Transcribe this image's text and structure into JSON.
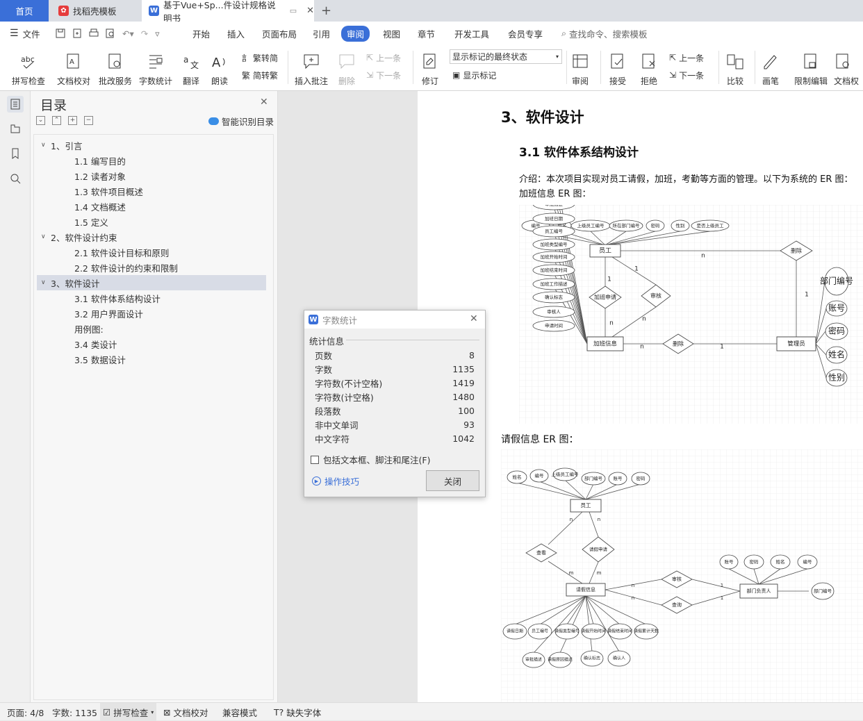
{
  "tabs": {
    "home": "首页",
    "template": "找稻壳模板",
    "doc": "基于Vue+Sp...件设计规格说明书"
  },
  "menu": {
    "file": "文件",
    "items": [
      "开始",
      "插入",
      "页面布局",
      "引用",
      "审阅",
      "视图",
      "章节",
      "开发工具",
      "会员专享"
    ],
    "active": "审阅",
    "search": "查找命令、搜索模板"
  },
  "ribbon": {
    "spell": "拼写检查",
    "doc_check": "文档校对",
    "annot_service": "批改服务",
    "word_count": "字数统计",
    "translate": "翻译",
    "read_aloud": "朗读",
    "t2s": "繁转简",
    "s2t": "简转繁",
    "insert_comment": "插入批注",
    "delete": "删除",
    "prev": "上一条",
    "next": "下一条",
    "revise": "修订",
    "track_state": "显示标记的最终状态",
    "show_markup": "显示标记",
    "review": "审阅",
    "accept": "接受",
    "reject": "拒绝",
    "prev2": "上一条",
    "next2": "下一条",
    "compare": "比较",
    "pen": "画笔",
    "restrict": "限制编辑",
    "doc_perm": "文档权"
  },
  "toc": {
    "title": "目录",
    "smart": "智能识别目录",
    "items": [
      {
        "label": "1、引言",
        "level": 1
      },
      {
        "label": "1.1  编写目的",
        "level": 2
      },
      {
        "label": "1.2  读者对象",
        "level": 2
      },
      {
        "label": "1.3  软件项目概述",
        "level": 2
      },
      {
        "label": "1.4  文档概述",
        "level": 2
      },
      {
        "label": "1.5  定义",
        "level": 2
      },
      {
        "label": "2、软件设计约束",
        "level": 1
      },
      {
        "label": "2.1  软件设计目标和原则",
        "level": 2
      },
      {
        "label": "2.2  软件设计的约束和限制",
        "level": 2
      },
      {
        "label": "3、软件设计",
        "level": 1
      },
      {
        "label": "3.1  软件体系结构设计",
        "level": 2
      },
      {
        "label": "3.2  用户界面设计",
        "level": 2
      },
      {
        "label": "用例图:",
        "level": 2
      },
      {
        "label": "3.4  类设计",
        "level": 2
      },
      {
        "label": "3.5  数据设计",
        "level": 2
      }
    ]
  },
  "document": {
    "h1": "3、软件设计",
    "h2": "3.1  软件体系结构设计",
    "intro1": "介绍：本次项目实现对员工请假，加班，考勤等方面的管理。以下为系统的 ER 图：",
    "intro2": "加班信息 ER 图：",
    "leave_caption": "请假信息 ER 图："
  },
  "er1": {
    "top_attrs": [
      "编号",
      "姓名",
      "上级员工编号",
      "所在部门编号",
      "密码",
      "性别",
      "是否上级员工"
    ],
    "employee": "员工",
    "delete1": "删除",
    "overtime_apply": "加班申请",
    "audit": "审核",
    "overtime_info": "加班信息",
    "delete2": "删除",
    "manager": "管理员",
    "left_attrs": [
      "审批描述",
      "加班日期",
      "员工编号",
      "加班类型编号",
      "加班开始时间",
      "加班结束时间",
      "加班工作描述",
      "确认标志",
      "审核人",
      "申请时间"
    ],
    "right_attrs": [
      "部门编号",
      "账号",
      "密码",
      "姓名",
      "性别"
    ],
    "n1": "n",
    "one1": "1",
    "one2": "1",
    "n2": "n",
    "n3": "n",
    "one3": "1",
    "n4": "n",
    "one4": "1"
  },
  "er2": {
    "top_attrs": [
      "姓名",
      "编号",
      "上级员工编号",
      "部门编号",
      "账号",
      "密码"
    ],
    "employee": "员工",
    "view": "查看",
    "apply": "请假申请",
    "leave_info": "请假信息",
    "audit": "审核",
    "query": "查询",
    "dept_head": "部门负责人",
    "right_attrs": [
      "账号",
      "密码",
      "姓名",
      "编号"
    ],
    "dept_no": "部门编号",
    "bottom1": [
      "请假日期",
      "员工编号",
      "请假类型编号",
      "请假开始时间",
      "请假结束时间",
      "请假累计天数"
    ],
    "bottom2": [
      "审批描述",
      "请假原因描述",
      "确认标志",
      "确认人"
    ],
    "n": "n",
    "m": "m",
    "one": "1"
  },
  "dialog": {
    "title": "字数统计",
    "group": "统计信息",
    "rows": [
      {
        "label": "页数",
        "value": "8"
      },
      {
        "label": "字数",
        "value": "1135"
      },
      {
        "label": "字符数(不计空格)",
        "value": "1419"
      },
      {
        "label": "字符数(计空格)",
        "value": "1480"
      },
      {
        "label": "段落数",
        "value": "100"
      },
      {
        "label": "非中文单词",
        "value": "93"
      },
      {
        "label": "中文字符",
        "value": "1042"
      }
    ],
    "checkbox": "包括文本框、脚注和尾注(F)",
    "tips": "操作技巧",
    "close": "关闭"
  },
  "status": {
    "page": "页面: 4/8",
    "words": "字数: 1135",
    "spell": "拼写检查",
    "doc_check": "文档校对",
    "compat": "兼容模式",
    "missing_font": "缺失字体"
  },
  "colors": {
    "accent": "#3a6fd8",
    "wps_red": "#e63c3c"
  }
}
